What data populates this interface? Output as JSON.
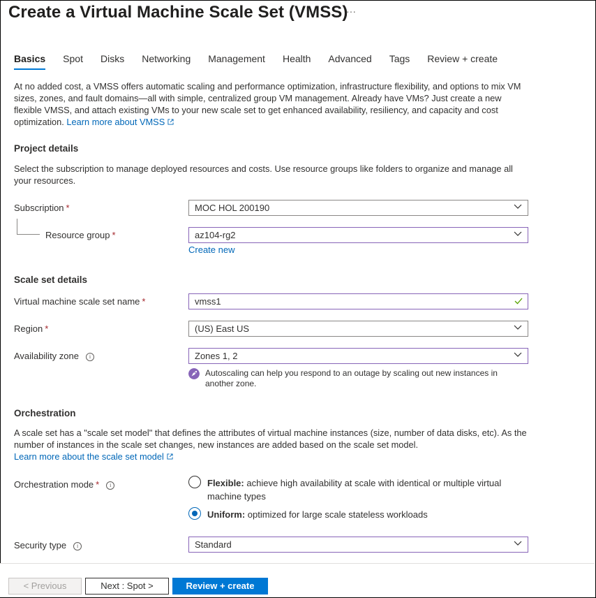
{
  "header": {
    "title": "Create a Virtual Machine Scale Set (VMSS)",
    "more": "···"
  },
  "tabs": [
    {
      "label": "Basics",
      "active": true
    },
    {
      "label": "Spot"
    },
    {
      "label": "Disks"
    },
    {
      "label": "Networking"
    },
    {
      "label": "Management"
    },
    {
      "label": "Health"
    },
    {
      "label": "Advanced"
    },
    {
      "label": "Tags"
    },
    {
      "label": "Review + create"
    }
  ],
  "intro": {
    "text": "At no added cost, a VMSS offers automatic scaling and performance optimization, infrastructure flexibility, and options to mix VM sizes, zones, and fault domains—all with simple, centralized group VM management. Already have VMs? Just create a new flexible VMSS, and attach existing VMs to your new scale set to get enhanced availability, resiliency, and capacity and cost optimization.",
    "link": "Learn more about VMSS"
  },
  "project": {
    "heading": "Project details",
    "desc": "Select the subscription to manage deployed resources and costs. Use resource groups like folders to organize and manage all your resources.",
    "subscription_label": "Subscription",
    "subscription_value": "MOC HOL 200190",
    "rg_label": "Resource group",
    "rg_value": "az104-rg2",
    "create_new": "Create new"
  },
  "scale": {
    "heading": "Scale set details",
    "name_label": "Virtual machine scale set name",
    "name_value": "vmss1",
    "region_label": "Region",
    "region_value": "(US) East US",
    "zone_label": "Availability zone",
    "zone_value": "Zones 1, 2",
    "zone_note": "Autoscaling can help you respond to an outage by scaling out new instances in another zone."
  },
  "orchestration": {
    "heading": "Orchestration",
    "desc": "A scale set has a \"scale set model\" that defines the attributes of virtual machine instances (size, number of data disks, etc). As the number of instances in the scale set changes, new instances are added based on the scale set model.",
    "link": "Learn more about the scale set model",
    "mode_label": "Orchestration mode",
    "flexible_title": "Flexible:",
    "flexible_desc": "achieve high availability at scale with identical or multiple virtual machine types",
    "uniform_title": "Uniform:",
    "uniform_desc": "optimized for large scale stateless workloads",
    "security_label": "Security type",
    "security_value": "Standard"
  },
  "footer": {
    "previous": "< Previous",
    "next": "Next : Spot >",
    "review": "Review + create"
  },
  "colors": {
    "accent": "#0078d4",
    "link": "#0067b8",
    "focus": "#8764b8",
    "required": "#a4262c",
    "valid": "#57a300"
  }
}
